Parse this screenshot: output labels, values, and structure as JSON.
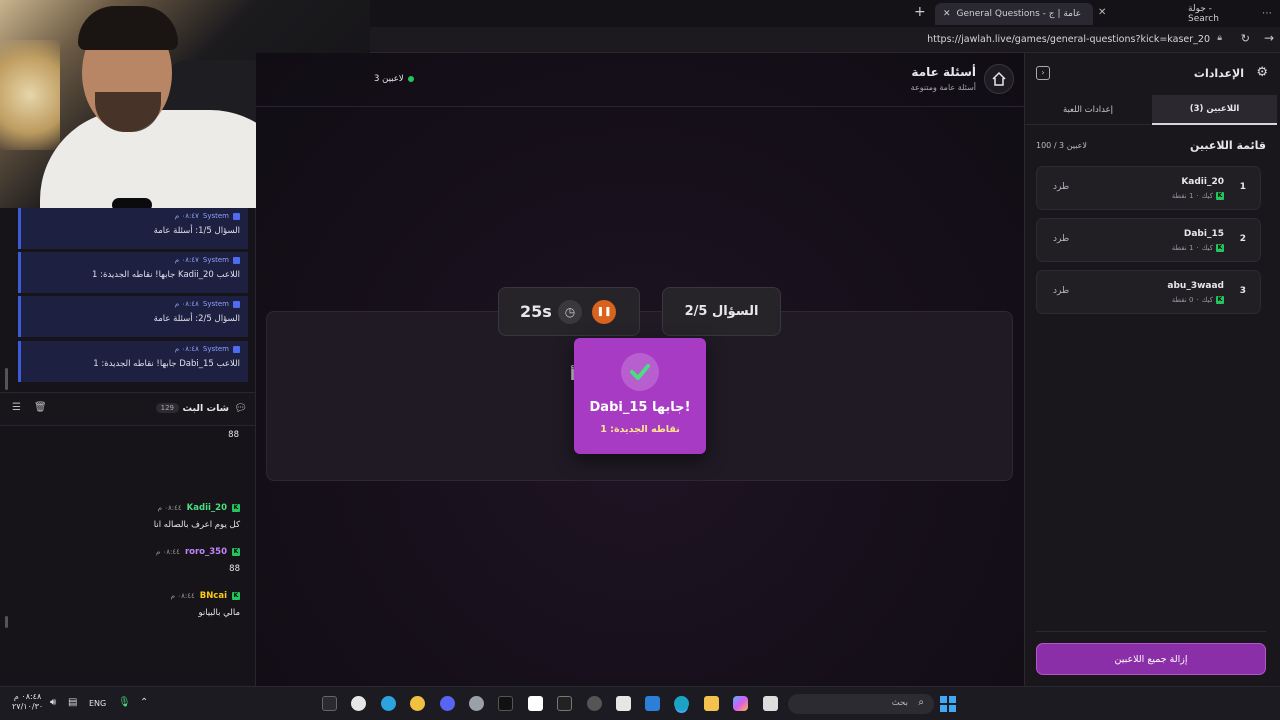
{
  "browser": {
    "tab_active_title": "General Questions - أسئلة عامة | ج...",
    "tab_search_label": "جولة - Search",
    "url": "https://jawlah.live/games/general-questions?kick=kaser_20"
  },
  "chat": {
    "system_messages": [
      {
        "sender": "System",
        "time": "٠٨:٤٧ م",
        "text": "السؤال 1/5: أسئلة عامة"
      },
      {
        "sender": "System",
        "time": "٠٨:٤٧ م",
        "text": "اللاعب Kadii_20 جابها! نقاطه الجديدة: 1"
      },
      {
        "sender": "System",
        "time": "٠٨:٤٨ م",
        "text": "السؤال 2/5: أسئلة عامة"
      },
      {
        "sender": "System",
        "time": "٠٨:٤٨ م",
        "text": "اللاعب Dabi_15 جابها! نقاطه الجديدة: 1"
      }
    ],
    "stream_chat_title": "شات البث",
    "stream_chat_count": "129",
    "first_line": "88",
    "messages": [
      {
        "user": "Kadii_20",
        "time": "٠٨:٤٤ م",
        "text": "كل يوم اعرف بالصاله انا",
        "color": "#4ade80"
      },
      {
        "user": "roro_350",
        "time": "٠٨:٤٤ م",
        "text": "88",
        "color": "#c084fc"
      },
      {
        "user": "BNcai",
        "time": "٠٨:٤٤ م",
        "text": "مالي بالبيانو",
        "color": "#facc15"
      }
    ]
  },
  "game": {
    "title": "أسئلة عامة",
    "subtitle": "أسئلة عامة ومتنوعة",
    "players_online": "3 لاعبين",
    "question_label": "السؤال 2/5",
    "timer": "25s",
    "popup_title": "Dabi_15 جابها!",
    "popup_sub": "نقاطه الجديدة: 1",
    "hidden_question_fragment": "أ"
  },
  "settings": {
    "title": "الإعدادات",
    "tab_players": "اللاعبين (3)",
    "tab_game": "إعدادات اللعبة",
    "list_title": "قائمة اللاعبين",
    "list_count": "100 / 3 لاعبين",
    "players": [
      {
        "rank": "1",
        "name": "Kadii_20",
        "platform": "كيك",
        "points": "1 نقطة",
        "kick_label": "طرد"
      },
      {
        "rank": "2",
        "name": "Dabi_15",
        "platform": "كيك",
        "points": "1 نقطة",
        "kick_label": "طرد"
      },
      {
        "rank": "3",
        "name": "abu_3waad",
        "platform": "كيك",
        "points": "0 نقطة",
        "kick_label": "طرد"
      }
    ],
    "remove_all": "إزالة جميع اللاعبين"
  },
  "taskbar": {
    "time": "٠٨:٤٨ م",
    "date": "٢٧/١٠/٣٠",
    "lang": "ENG",
    "search_placeholder": "بحث"
  },
  "colors": {
    "accent_purple": "#a83bc4",
    "kick_green": "#22c55e",
    "timer_orange": "#d9621e"
  }
}
